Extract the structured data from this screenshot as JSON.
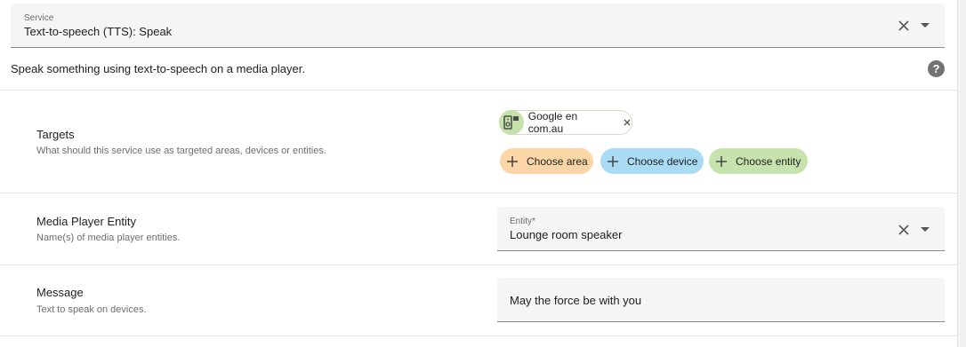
{
  "service": {
    "label": "Service",
    "value": "Text-to-speech (TTS): Speak",
    "clear_icon": "close-icon",
    "dropdown_icon": "menu-down-icon"
  },
  "description": "Speak something using text-to-speech on a media player.",
  "help_icon": {
    "name": "help-circle-icon",
    "glyph": "?"
  },
  "targets": {
    "title": "Targets",
    "subtitle": "What should this service use as targeted areas, devices or entities.",
    "selected": [
      {
        "label": "Google en com.au",
        "icon": "speaker-icon"
      }
    ],
    "add_buttons": [
      {
        "label": "Choose area",
        "color": "#fcd6a7"
      },
      {
        "label": "Choose device",
        "color": "#a9dbf5"
      },
      {
        "label": "Choose entity",
        "color": "#c7e3ad"
      }
    ]
  },
  "media_player": {
    "title": "Media Player Entity",
    "subtitle": "Name(s) of media player entities.",
    "field_label": "Entity*",
    "value": "Lounge room speaker"
  },
  "message": {
    "title": "Message",
    "subtitle": "Text to speak on devices.",
    "value": "May the force be with you"
  }
}
